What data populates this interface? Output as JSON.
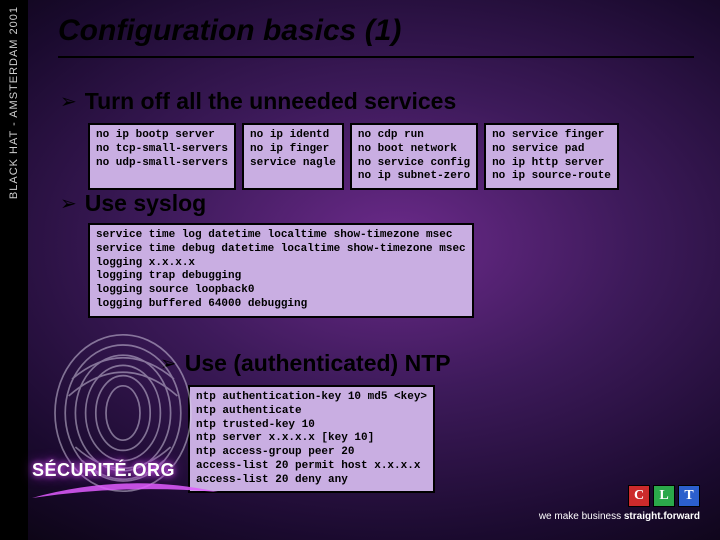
{
  "sidebar": {
    "label": "BLACK HAT - AMSTERDAM 2001"
  },
  "title": "Configuration basics (1)",
  "bullets": {
    "b1": "Turn off all the unneeded services",
    "b2": "Use syslog",
    "b3": "Use (authenticated) NTP"
  },
  "code": {
    "box1": "no ip bootp server\nno tcp-small-servers\nno udp-small-servers",
    "box2": "no ip identd\nno ip finger\nservice nagle",
    "box3": "no cdp run\nno boot network\nno service config\nno ip subnet-zero",
    "box4": "no service finger\nno service pad\nno ip http server\nno ip source-route",
    "syslog": "service time log datetime localtime show-timezone msec\nservice time debug datetime localtime show-timezone msec\nlogging x.x.x.x\nlogging trap debugging\nlogging source loopback0\nlogging buffered 64000 debugging",
    "ntp": "ntp authentication-key 10 md5 <key>\nntp authenticate\nntp trusted-key 10\nntp server x.x.x.x [key 10]\nntp access-group peer 20\naccess-list 20 permit host x.x.x.x\naccess-list 20 deny any"
  },
  "logo": {
    "text": "SÉCURITÉ.ORG"
  },
  "footer": {
    "boxes": [
      "C",
      "L",
      "T"
    ],
    "colors": [
      "#cc2b2b",
      "#2ba84a",
      "#2b5fcc"
    ],
    "tagline_prefix": "we make business ",
    "tagline_bold": "straight.forward"
  }
}
